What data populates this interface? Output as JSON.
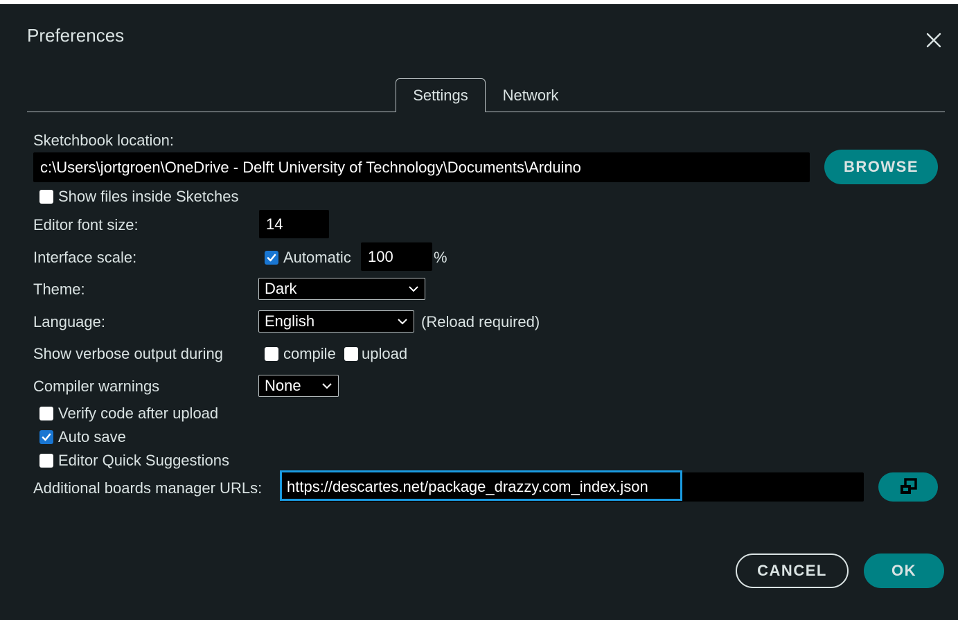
{
  "dialog": {
    "title": "Preferences",
    "close_icon": "close-icon"
  },
  "tabs": [
    {
      "label": "Settings",
      "active": true
    },
    {
      "label": "Network",
      "active": false
    }
  ],
  "sketchbook": {
    "label": "Sketchbook location:",
    "value": "c:\\Users\\jortgroen\\OneDrive - Delft University of Technology\\Documents\\Arduino",
    "browse_label": "BROWSE",
    "show_files_label": "Show files inside Sketches",
    "show_files_checked": false
  },
  "editor_font": {
    "label": "Editor font size:",
    "value": "14"
  },
  "interface_scale": {
    "label": "Interface scale:",
    "automatic_label": "Automatic",
    "automatic_checked": true,
    "value": "100",
    "unit": "%"
  },
  "theme": {
    "label": "Theme:",
    "selected": "Dark"
  },
  "language": {
    "label": "Language:",
    "selected": "English",
    "note": "(Reload required)"
  },
  "verbose": {
    "label": "Show verbose output during",
    "compile_label": "compile",
    "compile_checked": false,
    "upload_label": "upload",
    "upload_checked": false
  },
  "compiler_warnings": {
    "label": "Compiler warnings",
    "selected": "None"
  },
  "options": {
    "verify_label": "Verify code after upload",
    "verify_checked": false,
    "autosave_label": "Auto save",
    "autosave_checked": true,
    "quick_suggestions_label": "Editor Quick Suggestions",
    "quick_suggestions_checked": false
  },
  "boards_urls": {
    "label": "Additional boards manager URLs:",
    "value": "https://descartes.net/package_drazzy.com_index.json",
    "open_window_icon": "open-window-icon"
  },
  "footer": {
    "cancel_label": "CANCEL",
    "ok_label": "OK"
  },
  "colors": {
    "background": "#171e21",
    "accent": "#008184",
    "text": "#dae3e3",
    "checkbox_checked": "#1976d2",
    "highlight": "#1a9ae0"
  }
}
